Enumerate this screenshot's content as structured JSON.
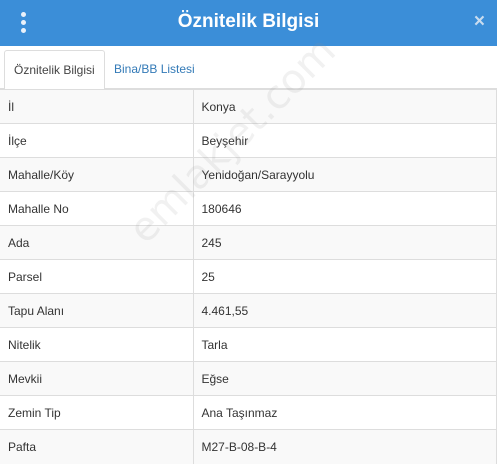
{
  "header": {
    "title": "Öznitelik Bilgisi",
    "close_label": "×"
  },
  "tabs": [
    {
      "label": "Öznitelik Bilgisi",
      "active": true
    },
    {
      "label": "Bina/BB Listesi",
      "active": false
    }
  ],
  "rows": [
    {
      "key": "İl",
      "value": "Konya"
    },
    {
      "key": "İlçe",
      "value": "Beyşehir"
    },
    {
      "key": "Mahalle/Köy",
      "value": "Yenidoğan/Sarayyolu"
    },
    {
      "key": "Mahalle No",
      "value": "180646"
    },
    {
      "key": "Ada",
      "value": "245"
    },
    {
      "key": "Parsel",
      "value": "25"
    },
    {
      "key": "Tapu Alanı",
      "value": "4.461,55"
    },
    {
      "key": "Nitelik",
      "value": "Tarla"
    },
    {
      "key": "Mevkii",
      "value": "Eğse"
    },
    {
      "key": "Zemin Tip",
      "value": "Ana Taşınmaz"
    },
    {
      "key": "Pafta",
      "value": "M27-B-08-B-4"
    }
  ],
  "watermark": "emlakjet.com",
  "colors": {
    "header_bg": "#3b8ed8",
    "tab_link": "#337ab7",
    "border": "#dddddd"
  },
  "icons": {
    "menu": "vertical-ellipsis-icon",
    "close": "close-icon"
  }
}
